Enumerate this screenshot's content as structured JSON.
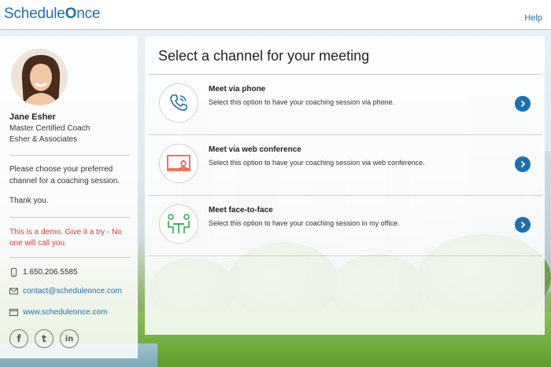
{
  "header": {
    "logo_left": "Schedule",
    "logo_o": "O",
    "logo_right": "nce",
    "help": "Help"
  },
  "profile": {
    "name": "Jane Esher",
    "title": "Master Certified Coach",
    "company": "Esher & Associates",
    "message": "Please choose your preferred channel for a coaching session.",
    "thanks": "Thank you.",
    "demo": "This is a demo. Give it a try - No one will call you.",
    "phone": "1.650.206.5585",
    "email": "contact@scheduleonce.com",
    "website": "www.scheduleonce.com",
    "socials": [
      {
        "icon": "facebook-icon",
        "glyph": "f"
      },
      {
        "icon": "twitter-icon",
        "glyph": "t"
      },
      {
        "icon": "linkedin-icon",
        "glyph": "in"
      }
    ]
  },
  "main": {
    "heading": "Select a channel for your meeting",
    "options": [
      {
        "title": "Meet via phone",
        "desc": "Select this option to have your coaching session via phone.",
        "icon": "phone-icon"
      },
      {
        "title": "Meet via web conference",
        "desc": "Select this option to have your coaching session via web conference.",
        "icon": "web-conference-icon"
      },
      {
        "title": "Meet face-to-face",
        "desc": "Select this option to have your coaching session in my office.",
        "icon": "face-to-face-icon"
      }
    ]
  },
  "colors": {
    "brand": "#1d6fae",
    "demo_text": "#e03a2f",
    "web_icon": "#e8512b",
    "face_icon": "#2aa84a"
  }
}
